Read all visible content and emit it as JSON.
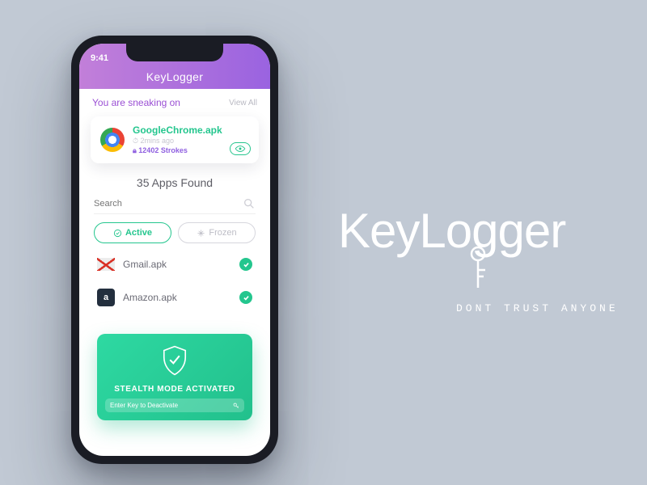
{
  "statusbar": {
    "time": "9:41"
  },
  "appbar": {
    "title": "KeyLogger"
  },
  "sneak": {
    "title": "You are sneaking on",
    "view_all": "View All"
  },
  "featured": {
    "name": "GoogleChrome.apk",
    "time": "2mins ago",
    "strokes": "12402 Strokes"
  },
  "apps_found": "35 Apps Found",
  "search": {
    "placeholder": "Search"
  },
  "filters": {
    "active_label": "Active",
    "frozen_label": "Frozen"
  },
  "apps": [
    {
      "name": "Gmail.apk"
    },
    {
      "name": "Amazon.apk"
    }
  ],
  "stealth": {
    "title": "STEALTH MODE ACTIVATED",
    "subtitle": "Enter Key to Deactivate"
  },
  "brand": {
    "key": "Key",
    "logger": "Logger",
    "tagline": "DONT TRUST ANYONE"
  }
}
